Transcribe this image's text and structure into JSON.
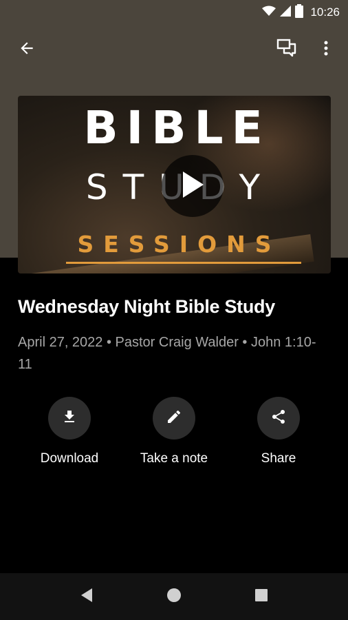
{
  "status_bar": {
    "time": "10:26",
    "icons": [
      "wifi-icon",
      "cell-signal-icon",
      "battery-icon"
    ]
  },
  "app_bar": {
    "icons": [
      "arrow-back-icon",
      "chat-bubbles-icon",
      "more-vert-icon"
    ]
  },
  "hero": {
    "word1": "BIBLE",
    "word2": "STUDY",
    "word3": "SESSIONS",
    "accent_color": "#e29b3b",
    "play_icon": "play-icon"
  },
  "sermon": {
    "title": "Wednesday Night Bible Study",
    "meta": "April 27, 2022 • Pastor Craig Walder • John 1:10-11"
  },
  "actions": [
    {
      "label": "Download",
      "icon": "download-icon"
    },
    {
      "label": "Take a note",
      "icon": "pencil-icon"
    },
    {
      "label": "Share",
      "icon": "share-icon"
    }
  ],
  "nav_bar": {
    "icons": [
      "nav-back-icon",
      "nav-home-icon",
      "nav-recents-icon"
    ]
  },
  "colors": {
    "header_bg": "#4b453c",
    "page_bg": "#000000",
    "action_circle": "#2d2d2d",
    "meta_text": "#a7a7a7"
  }
}
